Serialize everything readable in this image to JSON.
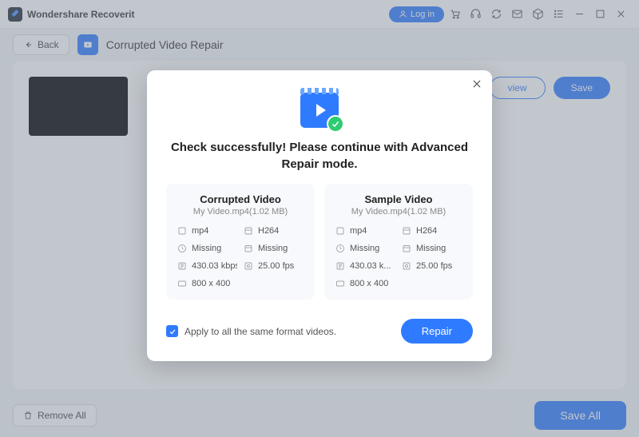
{
  "titlebar": {
    "app_name": "Wondershare Recoverit",
    "login_label": "Log in"
  },
  "toolbar": {
    "back_label": "Back",
    "feature_title": "Corrupted Video Repair"
  },
  "row_actions": {
    "preview_label": "view",
    "save_label": "Save"
  },
  "footer": {
    "remove_all_label": "Remove All",
    "save_all_label": "Save All"
  },
  "modal": {
    "title": "Check successfully! Please continue with Advanced Repair mode.",
    "apply_label": "Apply to all the same format videos.",
    "repair_label": "Repair",
    "corrupted": {
      "heading": "Corrupted Video",
      "filename": "My Video.mp4(1.02   MB)",
      "format": "mp4",
      "codec": "H264",
      "duration": "Missing",
      "created": "Missing",
      "bitrate": "430.03 kbps",
      "fps": "25.00 fps",
      "resolution": "800 x 400"
    },
    "sample": {
      "heading": "Sample Video",
      "filename": "My Video.mp4(1.02   MB)",
      "format": "mp4",
      "codec": "H264",
      "duration": "Missing",
      "created": "Missing",
      "bitrate": "430.03 k...",
      "fps": "25.00 fps",
      "resolution": "800 x 400"
    }
  }
}
